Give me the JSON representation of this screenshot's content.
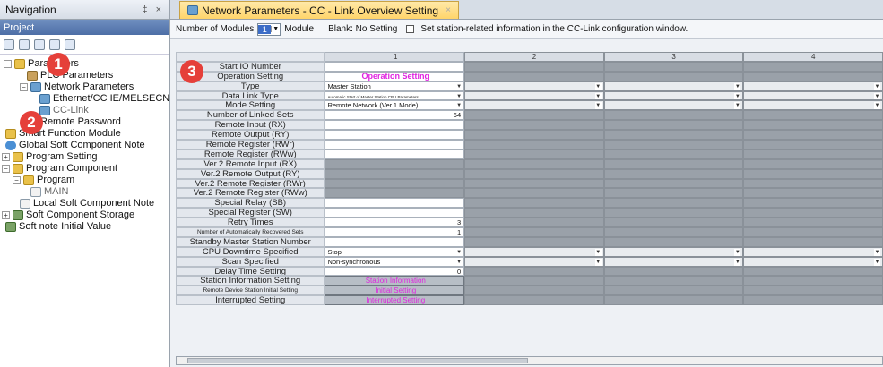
{
  "nav": {
    "title": "Navigation",
    "controls": "‡ ×",
    "project_label": "Project",
    "tree": [
      {
        "label": "Parameters",
        "icon": "folder-icon",
        "exp": "−"
      },
      {
        "label": "PLC Parameters",
        "icon": "config-icon"
      },
      {
        "label": "Network Parameters",
        "icon": "network-icon",
        "exp": "−"
      },
      {
        "label": "Ethernet/CC IE/MELSECN",
        "icon": "network-icon"
      },
      {
        "label": "CC-Link",
        "icon": "network-icon"
      },
      {
        "label": "Remote Password",
        "icon": "config-icon"
      },
      {
        "label": "Smart Function Module",
        "icon": "folder-icon"
      },
      {
        "label": "Global Soft Component Note",
        "icon": "globe-icon"
      },
      {
        "label": "Program Setting",
        "icon": "folder-icon",
        "exp": "+"
      },
      {
        "label": "Program Component",
        "icon": "folder-icon",
        "exp": "−"
      },
      {
        "label": "Program",
        "icon": "folder-icon",
        "exp": "−"
      },
      {
        "label": "MAIN",
        "icon": "document-icon"
      },
      {
        "label": "Local Soft Component Note",
        "icon": "document-icon"
      },
      {
        "label": "Soft Component Storage",
        "icon": "database-icon",
        "exp": "+"
      },
      {
        "label": "Soft note Initial Value",
        "icon": "database-icon"
      }
    ]
  },
  "badges": [
    "1",
    "2",
    "3"
  ],
  "tab": {
    "label": "Network Parameters - CC - Link Overview Setting",
    "close": "×"
  },
  "options": {
    "modules_label": "Number of Modules",
    "modules_value": "1",
    "module_unit": "Module",
    "blank_label": "Blank: No Setting",
    "checkbox_label": "Set station-related information in the CC-Link configuration window."
  },
  "grid": {
    "col_headers": [
      "1",
      "2",
      "3",
      "4"
    ],
    "rows": [
      {
        "label": "Start IO Number",
        "v": "",
        "t": "in"
      },
      {
        "label": "Operation Setting",
        "v": "Operation Setting",
        "t": "link"
      },
      {
        "label": "Type",
        "v": "Master Station",
        "t": "dd",
        "o": "dd"
      },
      {
        "label": "Data Link Type",
        "v": "Automatic Start of Master Station CPU Parameters",
        "t": "dd",
        "o": "dd",
        "tiny": true
      },
      {
        "label": "Mode Setting",
        "v": "Remote Network (Ver.1 Mode)",
        "t": "dd",
        "o": "dd"
      },
      {
        "label": "Number of Linked Sets",
        "v": "64",
        "t": "num"
      },
      {
        "label": "Remote Input (RX)",
        "v": "",
        "t": "in"
      },
      {
        "label": "Remote Output (RY)",
        "v": "",
        "t": "in"
      },
      {
        "label": "Remote Register (RWr)",
        "v": "",
        "t": "in"
      },
      {
        "label": "Remote Register (RWw)",
        "v": "",
        "t": "in"
      },
      {
        "label": "Ver.2 Remote Input (RX)",
        "v": "",
        "t": "gray"
      },
      {
        "label": "Ver.2 Remote Output (RY)",
        "v": "",
        "t": "gray"
      },
      {
        "label": "Ver.2 Remote Register (RWr)",
        "v": "",
        "t": "gray"
      },
      {
        "label": "Ver.2 Remote Register (RWw)",
        "v": "",
        "t": "gray"
      },
      {
        "label": "Special Relay (SB)",
        "v": "",
        "t": "in"
      },
      {
        "label": "Special Register (SW)",
        "v": "",
        "t": "in"
      },
      {
        "label": "Retry Times",
        "v": "3",
        "t": "num"
      },
      {
        "label": "Number of Automatically Recovered Sets",
        "v": "1",
        "t": "num",
        "small": true
      },
      {
        "label": "Standby Master Station Number",
        "v": "",
        "t": "in"
      },
      {
        "label": "CPU Downtime Specified",
        "v": "Stop",
        "t": "dd",
        "o": "dd"
      },
      {
        "label": "Scan Specified",
        "v": "Non-synchronous",
        "t": "dd",
        "o": "dd"
      },
      {
        "label": "Delay Time Setting",
        "v": "0",
        "t": "num"
      },
      {
        "label": "Station Information Setting",
        "v": "Station Information",
        "t": "btn"
      },
      {
        "label": "Remote Device Station Initial Setting",
        "v": "Initial Setting",
        "t": "btn",
        "small": true
      },
      {
        "label": "Interrupted Setting",
        "v": "Interrupted Setting",
        "t": "btn"
      }
    ]
  }
}
